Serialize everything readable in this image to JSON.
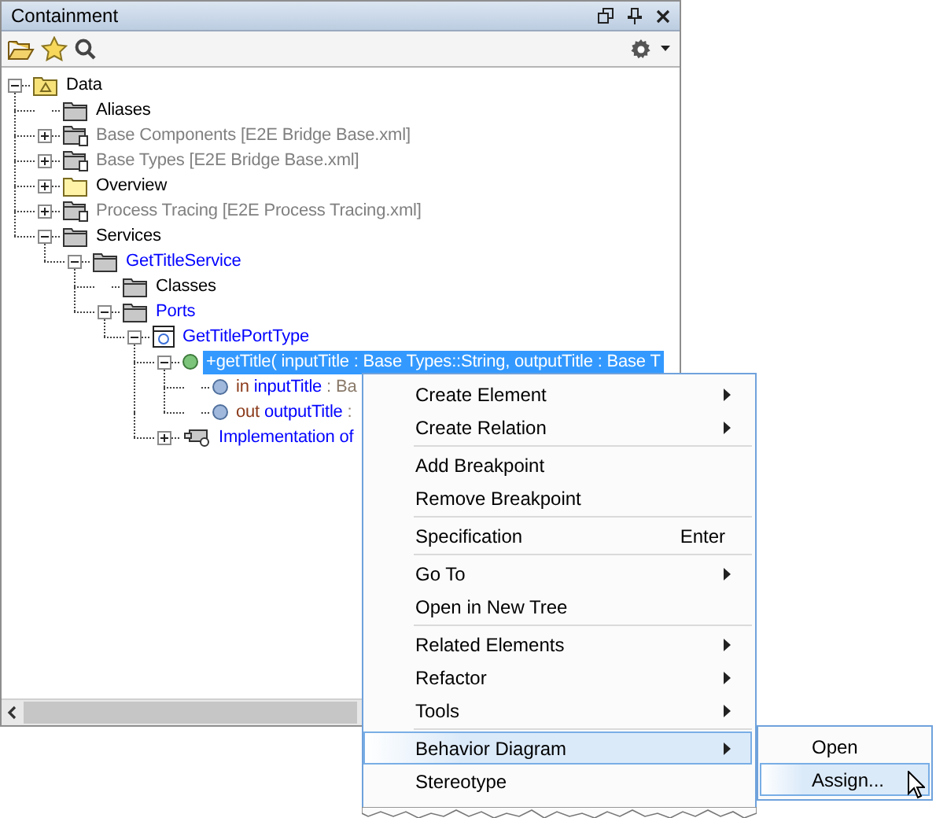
{
  "panel": {
    "title": "Containment"
  },
  "tree": [
    {
      "label": "Data",
      "kind": "model",
      "color": "#000000",
      "expanded": true,
      "selected": false,
      "children": [
        {
          "label": "Aliases",
          "kind": "package",
          "color": "#000000",
          "selected": false
        },
        {
          "label": "Base Components [E2E Bridge Base.xml]",
          "kind": "shared-package",
          "color": "#808080",
          "expanded": false,
          "selected": false
        },
        {
          "label": "Base Types [E2E Bridge Base.xml]",
          "kind": "shared-package",
          "color": "#808080",
          "expanded": false,
          "selected": false
        },
        {
          "label": "Overview",
          "kind": "folder",
          "color": "#000000",
          "expanded": false,
          "selected": false
        },
        {
          "label": "Process Tracing [E2E Process Tracing.xml]",
          "kind": "shared-package",
          "color": "#808080",
          "expanded": false,
          "selected": false
        },
        {
          "label": "Services",
          "kind": "package",
          "color": "#000000",
          "expanded": true,
          "selected": false,
          "children": [
            {
              "label": "GetTitleService",
              "kind": "package",
              "color": "#0000ff",
              "expanded": true,
              "selected": false,
              "children": [
                {
                  "label": "Classes",
                  "kind": "package",
                  "color": "#000000",
                  "selected": false
                },
                {
                  "label": "Ports",
                  "kind": "package",
                  "color": "#0000ff",
                  "expanded": true,
                  "selected": false,
                  "children": [
                    {
                      "label": "GetTitlePortType",
                      "kind": "port-type",
                      "color": "#0000ff",
                      "expanded": true,
                      "selected": false,
                      "children": [
                        {
                          "label": "+getTitle( inputTitle : Base Types::String, outputTitle : Base T",
                          "kind": "operation",
                          "expanded": true,
                          "selected": true,
                          "children": [
                            {
                              "direction": "in",
                              "label": "inputTitle",
                              "type": ": Ba",
                              "kind": "parameter",
                              "selected": false
                            },
                            {
                              "direction": "out",
                              "label": "outputTitle",
                              "type": ":",
                              "kind": "parameter",
                              "selected": false
                            }
                          ]
                        },
                        {
                          "label": "Implementation of",
                          "kind": "implementation",
                          "color": "#0000ff",
                          "expanded": false,
                          "selected": false
                        }
                      ]
                    }
                  ]
                }
              ]
            }
          ]
        }
      ]
    }
  ],
  "context_menu": {
    "groups": [
      [
        {
          "label": "Create Element",
          "submenu": true,
          "selected": false
        },
        {
          "label": "Create Relation",
          "submenu": true,
          "selected": false
        }
      ],
      [
        {
          "label": "Add Breakpoint",
          "submenu": false,
          "selected": false
        },
        {
          "label": "Remove Breakpoint",
          "submenu": false,
          "selected": false
        }
      ],
      [
        {
          "label": "Specification",
          "shortcut": "Enter",
          "submenu": false,
          "selected": false
        }
      ],
      [
        {
          "label": "Go To",
          "submenu": true,
          "selected": false
        },
        {
          "label": "Open in New Tree",
          "submenu": false,
          "selected": false
        }
      ],
      [
        {
          "label": "Related Elements",
          "submenu": true,
          "selected": false
        },
        {
          "label": "Refactor",
          "submenu": true,
          "selected": false
        },
        {
          "label": "Tools",
          "submenu": true,
          "selected": false
        }
      ],
      [
        {
          "label": "Behavior Diagram",
          "submenu": true,
          "selected": true
        },
        {
          "label": "Stereotype",
          "submenu": false,
          "selected": false
        }
      ]
    ]
  },
  "submenu": {
    "items": [
      {
        "label": "Open",
        "selected": false
      },
      {
        "label": "Assign...",
        "selected": true
      }
    ]
  }
}
